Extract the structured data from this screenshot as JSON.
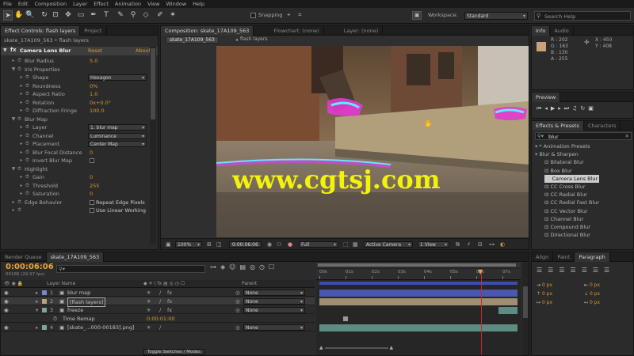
{
  "menu": [
    "File",
    "Edit",
    "Composition",
    "Layer",
    "Effect",
    "Animation",
    "View",
    "Window",
    "Help"
  ],
  "toolbar": {
    "snapping_label": "Snapping",
    "workspace_label": "Workspace:",
    "workspace_value": "Standard",
    "search_placeholder": "Search Help"
  },
  "effect_controls": {
    "tab_label": "Effect Controls: flash layers",
    "project_tab": "Project",
    "header": "skate_17A109_563 • flash layers",
    "effect_name": "Camera Lens Blur",
    "reset": "Reset",
    "about": "About...",
    "rows": [
      {
        "label": "Blur Radius",
        "value": "5.0",
        "indent": 1
      },
      {
        "label": "Iris Properties",
        "value": "",
        "indent": 1
      },
      {
        "label": "Shape",
        "value": "",
        "indent": 2,
        "dropdown": "Hexagon"
      },
      {
        "label": "Roundness",
        "value": "0%",
        "indent": 2
      },
      {
        "label": "Aspect Ratio",
        "value": "1.0",
        "indent": 2
      },
      {
        "label": "Rotation",
        "value": "0x+0.0°",
        "indent": 2
      },
      {
        "label": "Diffraction Fringe",
        "value": "100.0",
        "indent": 2
      },
      {
        "label": "Blur Map",
        "value": "",
        "indent": 1
      },
      {
        "label": "Layer",
        "value": "",
        "indent": 2,
        "dropdown": "1. blur map"
      },
      {
        "label": "Channel",
        "value": "",
        "indent": 2,
        "dropdown": "Luminance"
      },
      {
        "label": "Placement",
        "value": "",
        "indent": 2,
        "dropdown": "Center Map"
      },
      {
        "label": "Blur Focal Distance",
        "value": "0",
        "indent": 2
      },
      {
        "label": "Invert Blur Map",
        "value": "",
        "indent": 2,
        "check": ""
      },
      {
        "label": "Highlight",
        "value": "",
        "indent": 1
      },
      {
        "label": "Gain",
        "value": "0",
        "indent": 2
      },
      {
        "label": "Threshold",
        "value": "255",
        "indent": 2
      },
      {
        "label": "Saturation",
        "value": "0",
        "indent": 2
      },
      {
        "label": "Edge Behavior",
        "value": "",
        "indent": 1,
        "check": "Repeat Edge Pixels"
      },
      {
        "label": "",
        "value": "",
        "indent": 1,
        "check": "Use Linear Working"
      }
    ]
  },
  "composition": {
    "tab_label": "Composition: skate_17A109_563",
    "flowchart_tab": "Flowchart: (none)",
    "layer_tab": "Layer: (none)",
    "subtab_comp": "skate_17A109_563",
    "subtab_layer": "flash layers",
    "zoom": "100%",
    "timecode": "0:00:06:06",
    "resolution": "Full",
    "camera": "Active Camera",
    "views": "1 View",
    "watermark": "www.cgtsj.com"
  },
  "info": {
    "tab_label": "Info",
    "audio_tab": "Audio",
    "r": "R : 202",
    "g": "G : 163",
    "b": "B : 130",
    "a": "A : 255",
    "x": "X : 450",
    "y": "Y : 408",
    "swatch_color": "#ca9f7b"
  },
  "preview": {
    "tab_label": "Preview"
  },
  "effects_presets": {
    "tab_label": "Effects & Presets",
    "characters_tab": "Characters",
    "search_value": "blur",
    "items": [
      {
        "label": "* Animation Presets",
        "indent": 0,
        "selected": false
      },
      {
        "label": "Blur & Sharpen",
        "indent": 0,
        "selected": false
      },
      {
        "label": "Bilateral Blur",
        "indent": 1,
        "selected": false
      },
      {
        "label": "Box Blur",
        "indent": 1,
        "selected": false
      },
      {
        "label": "Camera Lens Blur",
        "indent": 1,
        "selected": true
      },
      {
        "label": "CC Cross Blur",
        "indent": 1,
        "selected": false
      },
      {
        "label": "CC Radial Blur",
        "indent": 1,
        "selected": false
      },
      {
        "label": "CC Radial Fast Blur",
        "indent": 1,
        "selected": false
      },
      {
        "label": "CC Vector Blur",
        "indent": 1,
        "selected": false
      },
      {
        "label": "Channel Blur",
        "indent": 1,
        "selected": false
      },
      {
        "label": "Compound Blur",
        "indent": 1,
        "selected": false
      },
      {
        "label": "Directional Blur",
        "indent": 1,
        "selected": false
      }
    ]
  },
  "timeline": {
    "render_tab": "Render Queue",
    "comp_tab": "skate_17A109_563",
    "timecode": "0:00:06:06",
    "fps_info": "00186 (29.97 fps)",
    "search_value": "",
    "col_source": "Layer Name",
    "col_parent": "Parent",
    "toggle_label": "Toggle Switches / Modes",
    "ruler_ticks": [
      "00s",
      "01s",
      "02s",
      "03s",
      "04s",
      "05s",
      "06s",
      "07s"
    ],
    "layers": [
      {
        "num": "1",
        "name": "blur map",
        "color": "#7a86c8",
        "parent": "None",
        "switch": "fx"
      },
      {
        "num": "2",
        "name": "[flash layers]",
        "color": "#b9a07f",
        "parent": "None",
        "switch": "fx"
      },
      {
        "num": "3",
        "name": "freeze",
        "color": "#7aa79c",
        "parent": "None",
        "switch": "fx"
      },
      {
        "num": "",
        "name": "Time Remap",
        "color": "",
        "parent": "",
        "switch": "",
        "sub_value": "0:00:01:00"
      },
      {
        "num": "4",
        "name": "[skate_...000-00183].png]",
        "color": "#7aa79c",
        "parent": "None",
        "switch": ""
      }
    ]
  },
  "align": {
    "align_tab": "Align",
    "paint_tab": "Paint",
    "paragraph_tab": "Paragraph",
    "field_a": "0 px",
    "field_b": "0 px",
    "field_c": "0 px",
    "field_d": "0 px",
    "field_e": "0 px",
    "field_f": "0 px"
  },
  "colors": {
    "accent": "#d79a2b",
    "playhead": "#c62b2b",
    "work_area": "#3a4fa5",
    "selected": "#3f5a88"
  }
}
